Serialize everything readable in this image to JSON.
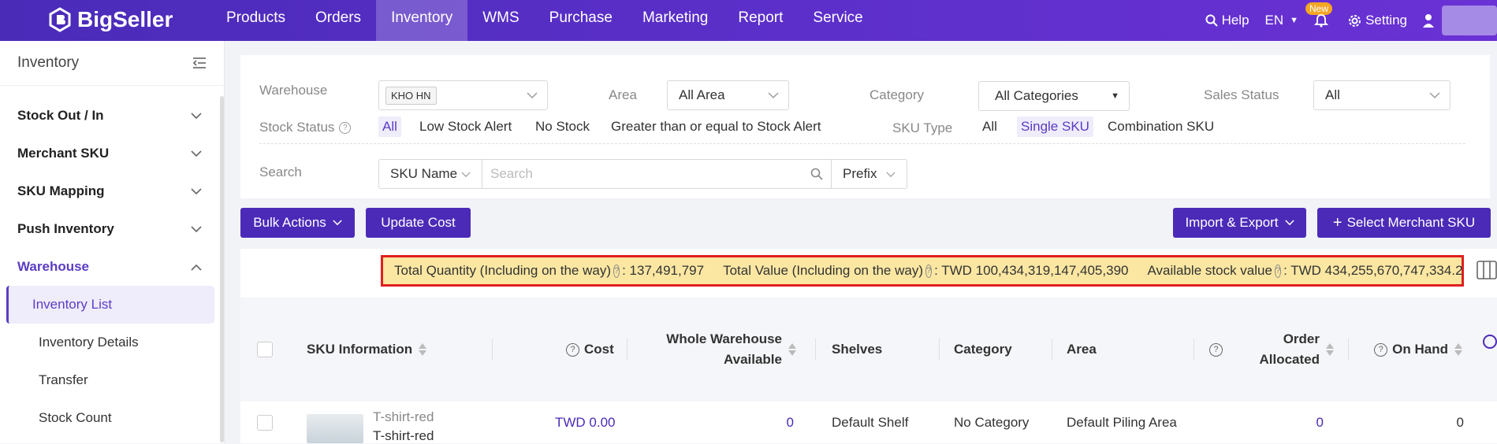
{
  "app": {
    "brand": "BigSeller"
  },
  "nav": {
    "items": [
      "Products",
      "Orders",
      "Inventory",
      "WMS",
      "Purchase",
      "Marketing",
      "Report",
      "Service"
    ],
    "active": "Inventory",
    "right": {
      "help": "Help",
      "lang": "EN",
      "badge": "New",
      "setting": "Setting"
    }
  },
  "sidebar": {
    "title": "Inventory",
    "groups": [
      {
        "label": "Stock Out / In"
      },
      {
        "label": "Merchant SKU"
      },
      {
        "label": "SKU Mapping"
      },
      {
        "label": "Push Inventory"
      },
      {
        "label": "Warehouse"
      }
    ],
    "sub": [
      {
        "label": "Inventory List"
      },
      {
        "label": "Inventory Details"
      },
      {
        "label": "Transfer"
      },
      {
        "label": "Stock Count"
      }
    ]
  },
  "filters": {
    "warehouse": {
      "label": "Warehouse",
      "tag": "KHO HN"
    },
    "area": {
      "label": "Area",
      "value": "All Area"
    },
    "category": {
      "label": "Category",
      "value": "All Categories"
    },
    "sales_status": {
      "label": "Sales Status",
      "value": "All"
    },
    "stock_status": {
      "label": "Stock Status",
      "options": [
        "All",
        "Low Stock Alert",
        "No Stock",
        "Greater than or equal to Stock Alert"
      ],
      "selected": "All"
    },
    "sku_type": {
      "label": "SKU Type",
      "options": [
        "All",
        "Single SKU",
        "Combination SKU"
      ],
      "selected": "Single SKU"
    },
    "search": {
      "label": "Search",
      "field": "SKU Name",
      "placeholder": "Search",
      "mode": "Prefix"
    }
  },
  "actions": {
    "bulk": "Bulk Actions",
    "update_cost": "Update Cost",
    "import_export": "Import & Export",
    "select_merchant": "Select Merchant SKU"
  },
  "summary": {
    "total_qty_label": "Total Quantity (Including on the way)",
    "total_qty": ": 137,491,797",
    "total_value_label": "Total Value (Including on the way)",
    "total_value": ": TWD 100,434,319,147,405,390",
    "avail_label": "Available stock value",
    "avail_value": ": TWD 434,255,670,747,334.2"
  },
  "table": {
    "headers": {
      "sku": "SKU Information",
      "cost": "Cost",
      "whole_a": "Whole Warehouse",
      "whole_b": "Available",
      "shelves": "Shelves",
      "category": "Category",
      "area": "Area",
      "order_a": "Order",
      "order_b": "Allocated",
      "on_hand": "On Hand"
    },
    "rows": [
      {
        "sku": "T-shirt-red",
        "sku_sub": "T-shirt-red",
        "cost": "TWD 0.00",
        "available": "0",
        "shelves": "Default Shelf",
        "category": "No Category",
        "area": "Default Piling Area",
        "allocated": "0",
        "on_hand": "0"
      }
    ]
  },
  "colors": {
    "brand": "#4b2ab8",
    "highlight": "#fbe7a2",
    "border_alert": "#e02020"
  }
}
